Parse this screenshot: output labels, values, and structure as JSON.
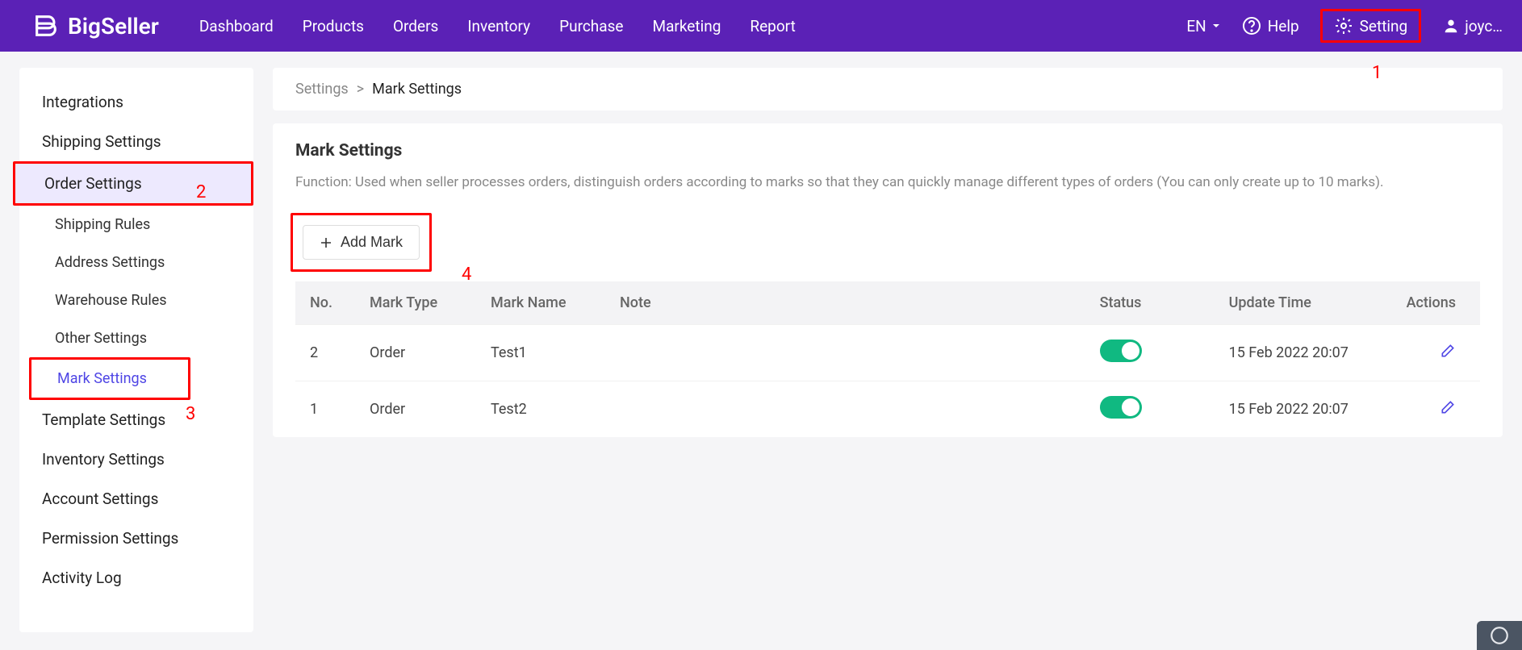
{
  "brand": "BigSeller",
  "topnav": [
    "Dashboard",
    "Products",
    "Orders",
    "Inventory",
    "Purchase",
    "Marketing",
    "Report"
  ],
  "header": {
    "lang": "EN",
    "help": "Help",
    "setting": "Setting",
    "user": "joyc…"
  },
  "annotations": {
    "a1": "1",
    "a2": "2",
    "a3": "3",
    "a4": "4"
  },
  "sidebar": {
    "items": [
      "Integrations",
      "Shipping Settings",
      "Order Settings",
      "Shipping Rules",
      "Address Settings",
      "Warehouse Rules",
      "Other Settings",
      "Mark Settings",
      "Template Settings",
      "Inventory Settings",
      "Account Settings",
      "Permission Settings",
      "Activity Log"
    ]
  },
  "breadcrumb": {
    "root": "Settings",
    "sep": ">",
    "current": "Mark Settings"
  },
  "page": {
    "title": "Mark Settings",
    "description": "Function: Used when seller processes orders, distinguish orders according to marks so that they can quickly manage different types of orders (You can only create up to 10 marks).",
    "add_label": "Add Mark"
  },
  "table": {
    "headers": [
      "No.",
      "Mark Type",
      "Mark Name",
      "Note",
      "Status",
      "Update Time",
      "Actions"
    ],
    "rows": [
      {
        "no": "2",
        "type": "Order",
        "name": "Test1",
        "note": "",
        "status": true,
        "update": "15 Feb 2022 20:07"
      },
      {
        "no": "1",
        "type": "Order",
        "name": "Test2",
        "note": "",
        "status": true,
        "update": "15 Feb 2022 20:07"
      }
    ]
  }
}
